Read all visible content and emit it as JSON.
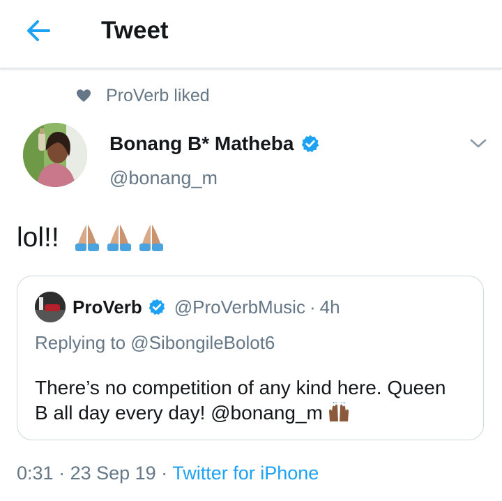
{
  "header": {
    "title": "Tweet",
    "back_icon": "arrow-left-icon",
    "accent": "#1da1f2"
  },
  "social_context": {
    "icon": "heart-icon",
    "text": "ProVerb liked"
  },
  "tweet": {
    "author_name": "Bonang B* Matheba",
    "handle": "@bonang_m",
    "text": "lol!!",
    "emoji": "folded-hands-icon x3",
    "menu_icon": "chevron-down-icon"
  },
  "quoted_tweet": {
    "author_name": "ProVerb",
    "handle": "@ProVerbMusic",
    "separator": "·",
    "time": "4h",
    "replying_to": "Replying to @SibongileBolot6",
    "text_line1": "There’s no competition of any kind here. Queen",
    "text_line2": "B all day every day! @bonang_m",
    "emoji": "raising-hands-icon"
  },
  "footer": {
    "time": "0:31",
    "sep1": " · ",
    "date": "23 Sep 19",
    "sep2": " · ",
    "source": "Twitter for iPhone"
  },
  "colors": {
    "text": "#14171a",
    "secondary": "#657786",
    "link": "#1da1f2",
    "border": "#ccd6dd"
  }
}
